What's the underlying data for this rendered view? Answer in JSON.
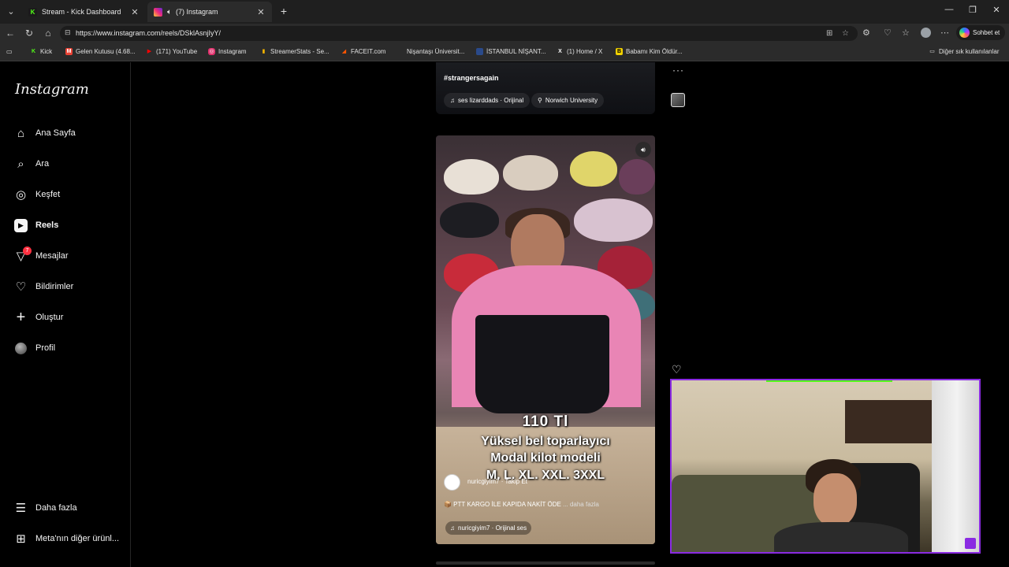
{
  "browser": {
    "tabs": [
      {
        "title": "Stream - Kick Dashboard",
        "favicon": "kick-icon",
        "active": false
      },
      {
        "title": "(7) Instagram",
        "favicon": "instagram-icon",
        "active": true
      }
    ],
    "url": "https://www.instagram.com/reels/DSklAsnjIyY/",
    "copilot_label": "Sohbet et",
    "bookmarks": [
      {
        "label": "Kick",
        "icon": "kick-icon",
        "color": "#53fc18"
      },
      {
        "label": "Gelen Kutusu (4.68...",
        "icon": "gmail-icon",
        "color": "#ea4335"
      },
      {
        "label": "(171) YouTube",
        "icon": "youtube-icon",
        "color": "#ff0000"
      },
      {
        "label": "Instagram",
        "icon": "instagram-icon",
        "color": "#e1306c"
      },
      {
        "label": "StreamerStats - Se...",
        "icon": "stats-icon",
        "color": "#f4b400"
      },
      {
        "label": "FACEIT.com",
        "icon": "faceit-icon",
        "color": "#ff5500"
      },
      {
        "label": "Nişantaşı Üniversit...",
        "icon": "",
        "color": "#2b2b2b"
      },
      {
        "label": "İSTANBUL NİŞANT...",
        "icon": "nisantasi-icon",
        "color": "#2a4a8a"
      },
      {
        "label": "(1) Home / X",
        "icon": "x-icon",
        "color": "#ffffff"
      },
      {
        "label": "Babamı Kim Öldür...",
        "icon": "folder-bookmark-icon",
        "color": "#f2d200"
      }
    ],
    "other_bookmarks_label": "Diğer sık kullanılanlar"
  },
  "sidebar": {
    "logo": "Instagram",
    "items": [
      {
        "label": "Ana Sayfa",
        "icon": "home-icon",
        "glyph": "⌂"
      },
      {
        "label": "Ara",
        "icon": "search-icon",
        "glyph": "⌕"
      },
      {
        "label": "Keşfet",
        "icon": "compass-icon",
        "glyph": "◎"
      },
      {
        "label": "Reels",
        "icon": "reels-icon",
        "glyph": "▶",
        "selected": true
      },
      {
        "label": "Mesajlar",
        "icon": "messenger-icon",
        "glyph": "▽",
        "badge": "7"
      },
      {
        "label": "Bildirimler",
        "icon": "heart-icon",
        "glyph": "♡"
      },
      {
        "label": "Oluştur",
        "icon": "plus-icon",
        "glyph": "+"
      },
      {
        "label": "Profil",
        "icon": "profile-avatar",
        "glyph": ""
      }
    ],
    "bottom_items": [
      {
        "label": "Daha fazla",
        "icon": "menu-icon",
        "glyph": "☰"
      },
      {
        "label": "Meta'nın diğer ürünl...",
        "icon": "meta-apps-icon",
        "glyph": "⊞"
      }
    ]
  },
  "prev_reel": {
    "hashtag": "#strangersagain",
    "audio": "ses   lizarddads · Orijinal",
    "location": "Norwich University"
  },
  "reel": {
    "overlay_lines": [
      "110 Tl",
      "Yüksel bel toparlayıcı",
      "Modal kilot modeli",
      "M. L. XL. XXL. 3XXL"
    ],
    "account": "nuricgiyim7",
    "follow_label": "Takip Et",
    "caption": "📦 PTT KARGO İLE KAPIDA NAKİT ÖDE",
    "caption_more": "... daha fazla",
    "audio": "nuricgiyim7 · Orijinal ses"
  }
}
